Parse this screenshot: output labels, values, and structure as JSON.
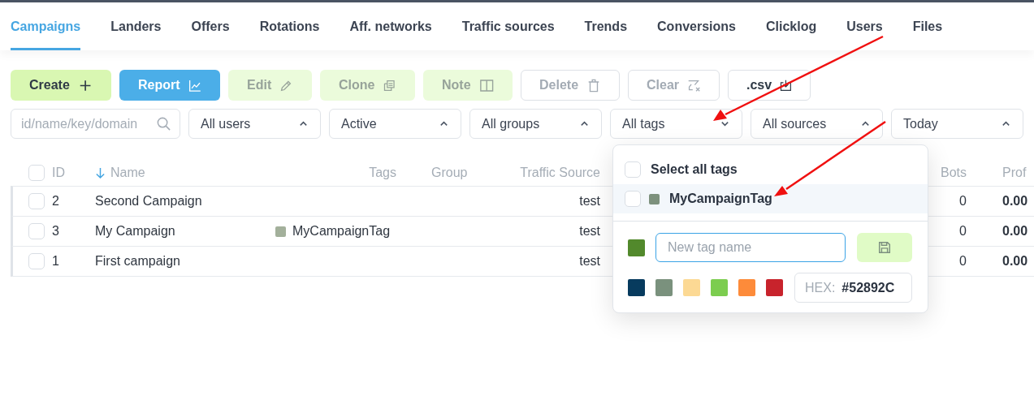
{
  "tabs": [
    {
      "label": "Campaigns",
      "selected": true
    },
    {
      "label": "Landers",
      "selected": false
    },
    {
      "label": "Offers",
      "selected": false
    },
    {
      "label": "Rotations",
      "selected": false
    },
    {
      "label": "Aff. networks",
      "selected": false
    },
    {
      "label": "Traffic sources",
      "selected": false
    },
    {
      "label": "Trends",
      "selected": false
    },
    {
      "label": "Conversions",
      "selected": false
    },
    {
      "label": "Clicklog",
      "selected": false
    },
    {
      "label": "Users",
      "selected": false
    },
    {
      "label": "Files",
      "selected": false
    }
  ],
  "toolbar": [
    {
      "label": "Create",
      "kind": "green",
      "disabled": false
    },
    {
      "label": "Report",
      "kind": "blue",
      "disabled": false
    },
    {
      "label": "Edit",
      "kind": "green",
      "disabled": true
    },
    {
      "label": "Clone",
      "kind": "green",
      "disabled": true
    },
    {
      "label": "Note",
      "kind": "green",
      "disabled": true
    },
    {
      "label": "Delete",
      "kind": "outline",
      "disabled": true
    },
    {
      "label": "Clear",
      "kind": "outline",
      "disabled": true
    },
    {
      "label": ".csv",
      "kind": "outline",
      "disabled": false
    }
  ],
  "search": {
    "placeholder": "id/name/key/domain"
  },
  "filters": [
    {
      "value": "All users",
      "expanded": false
    },
    {
      "value": "Active",
      "expanded": false
    },
    {
      "value": "All groups",
      "expanded": false
    },
    {
      "value": "All tags",
      "expanded": true
    },
    {
      "value": "All sources",
      "expanded": false
    },
    {
      "value": "Today",
      "expanded": false
    }
  ],
  "table": {
    "columns": {
      "id": "ID",
      "name": "Name",
      "tags": "Tags",
      "group": "Group",
      "traffic_source": "Traffic Source",
      "bots": "Bots",
      "profit": "Prof"
    },
    "header_checked": false,
    "rows": [
      {
        "checked": false,
        "id": "2",
        "name": "Second Campaign",
        "tag": null,
        "traffic_source": "test",
        "bots": "0",
        "profit": "0.00"
      },
      {
        "checked": false,
        "id": "3",
        "name": "My Campaign",
        "tag": {
          "label": "MyCampaignTag",
          "color": "#a3b09b"
        },
        "traffic_source": "test",
        "bots": "0",
        "profit": "0.00"
      },
      {
        "checked": false,
        "id": "1",
        "name": "First campaign",
        "tag": null,
        "traffic_source": "test",
        "bots": "0",
        "profit": "0.00"
      }
    ]
  },
  "tags_dropdown": {
    "select_all": {
      "label": "Select all tags",
      "checked": false
    },
    "tags": [
      {
        "label": "MyCampaignTag",
        "color": "#7d917d",
        "checked": false,
        "hovered": true
      }
    ],
    "new_tag": {
      "color": "#52892c",
      "placeholder": "New tag name"
    },
    "palette": [
      {
        "color": "#073b5e"
      },
      {
        "color": "#7a917d"
      },
      {
        "color": "#fcd994"
      },
      {
        "color": "#7ccd4f"
      },
      {
        "color": "#fd8b3a"
      },
      {
        "color": "#c8232c"
      }
    ],
    "hex_label": "HEX:",
    "hex_value": "#52892C"
  }
}
